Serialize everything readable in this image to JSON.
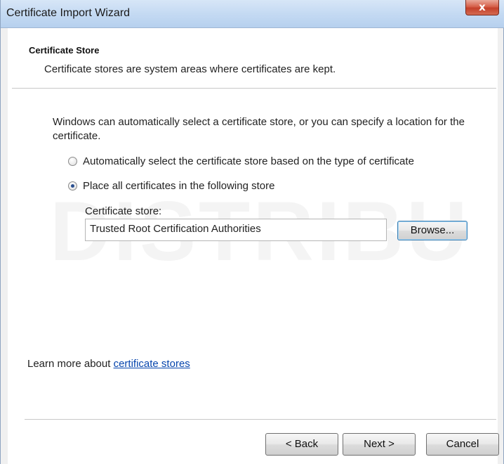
{
  "window": {
    "title": "Certificate Import Wizard",
    "close_glyph": "x"
  },
  "header": {
    "title": "Certificate Store",
    "description": "Certificate stores are system areas where certificates are kept."
  },
  "intro": "Windows can automatically select a certificate store, or you can specify a location for the certificate.",
  "options": {
    "auto_label": "Automatically select the certificate store based on the type of certificate",
    "auto_checked": false,
    "manual_label": "Place all certificates in the following store",
    "manual_checked": true
  },
  "store": {
    "label": "Certificate store:",
    "value": "Trusted Root Certification Authorities",
    "browse_label": "Browse..."
  },
  "learn_more": {
    "prefix": "Learn more about ",
    "link": "certificate stores"
  },
  "footer": {
    "back_label": "< Back",
    "next_label": "Next >",
    "cancel_label": "Cancel"
  },
  "watermark": {
    "text": "DISTRIBU"
  }
}
